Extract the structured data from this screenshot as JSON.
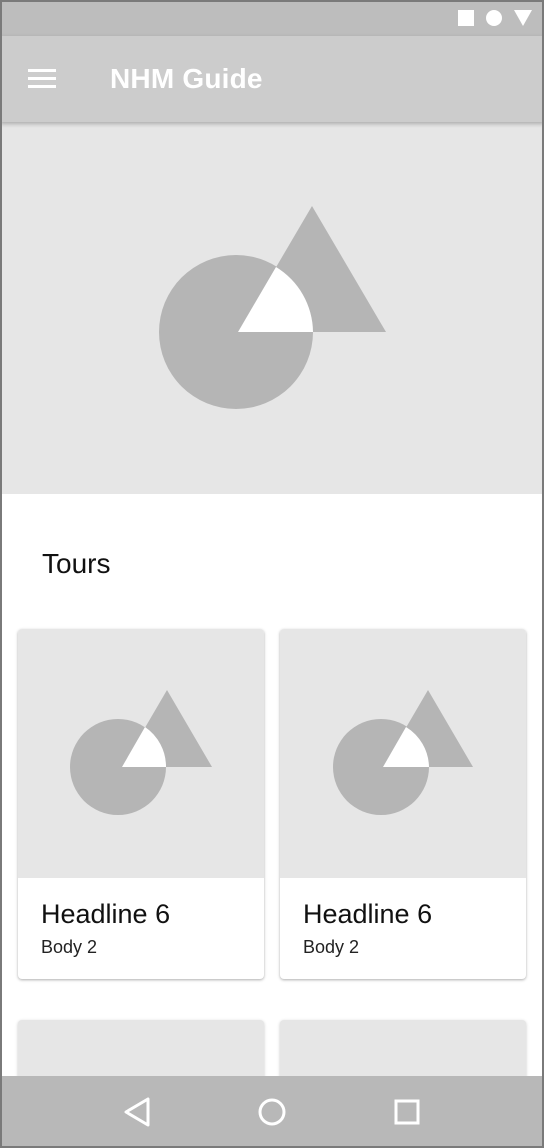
{
  "status_bar": {
    "icons": [
      "square-icon",
      "circle-icon",
      "triangle-icon"
    ]
  },
  "app_bar": {
    "menu_icon": "hamburger-menu-icon",
    "title": "NHM Guide"
  },
  "hero": {
    "image": "placeholder-image-icon"
  },
  "section": {
    "title": "Tours"
  },
  "cards": [
    {
      "headline": "Headline 6",
      "body": "Body 2",
      "image": "placeholder-image-icon"
    },
    {
      "headline": "Headline 6",
      "body": "Body 2",
      "image": "placeholder-image-icon"
    }
  ],
  "nav_bar": {
    "back": "back-triangle-icon",
    "home": "home-circle-icon",
    "recents": "recents-square-icon"
  },
  "colors": {
    "status_bar": "#bdbdbd",
    "app_bar": "#cccccc",
    "placeholder_bg": "#e6e6e6",
    "placeholder_shape": "#b5b5b5",
    "nav_bar": "#b8b8b8"
  }
}
